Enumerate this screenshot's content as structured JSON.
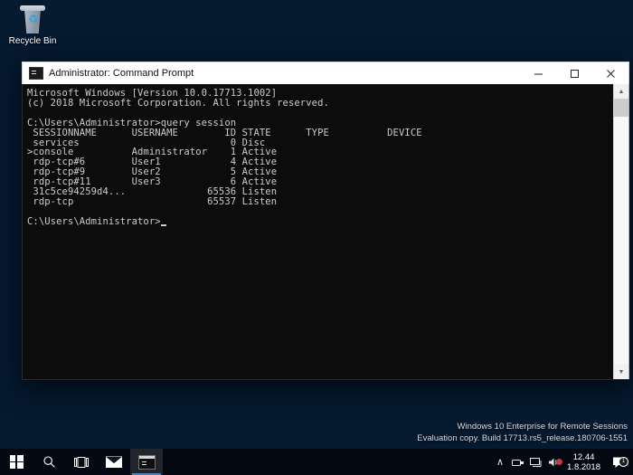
{
  "desktop": {
    "icons": [
      {
        "name": "recycle-bin",
        "label": "Recycle Bin"
      }
    ]
  },
  "window": {
    "title": "Administrator: Command Prompt",
    "icon": "cmd-icon",
    "controls": {
      "minimize": "–",
      "maximize": "□",
      "close": "✕"
    },
    "scrollbar": {
      "up_arrow": "▲",
      "down_arrow": "▼"
    },
    "console": {
      "banner": [
        "Microsoft Windows [Version 10.0.17713.1002]",
        "(c) 2018 Microsoft Corporation. All rights reserved."
      ],
      "prompt": "C:\\Users\\Administrator>",
      "command": "query session",
      "table": {
        "headers": [
          " SESSIONNAME",
          "USERNAME",
          "ID",
          "STATE",
          "TYPE",
          "DEVICE"
        ],
        "rows": [
          {
            "marker": " ",
            "sessionname": "services",
            "username": "",
            "id": "0",
            "state": "Disc",
            "type": "",
            "device": ""
          },
          {
            "marker": ">",
            "sessionname": "console",
            "username": "Administrator",
            "id": "1",
            "state": "Active",
            "type": "",
            "device": ""
          },
          {
            "marker": " ",
            "sessionname": "rdp-tcp#6",
            "username": "User1",
            "id": "4",
            "state": "Active",
            "type": "",
            "device": ""
          },
          {
            "marker": " ",
            "sessionname": "rdp-tcp#9",
            "username": "User2",
            "id": "5",
            "state": "Active",
            "type": "",
            "device": ""
          },
          {
            "marker": " ",
            "sessionname": "rdp-tcp#11",
            "username": "User3",
            "id": "6",
            "state": "Active",
            "type": "",
            "device": ""
          },
          {
            "marker": " ",
            "sessionname": "31c5ce94259d4...",
            "username": "",
            "id": "65536",
            "state": "Listen",
            "type": "",
            "device": ""
          },
          {
            "marker": " ",
            "sessionname": "rdp-tcp",
            "username": "",
            "id": "65537",
            "state": "Listen",
            "type": "",
            "device": ""
          }
        ]
      },
      "final_prompt": "C:\\Users\\Administrator>",
      "cursor": "_"
    }
  },
  "watermark": {
    "line1": "Windows 10 Enterprise for Remote Sessions",
    "line2": "Evaluation copy. Build 17713.rs5_release.180706-1551"
  },
  "taskbar": {
    "items": [
      {
        "name": "start-button",
        "icon": "windows-logo-icon",
        "active": false
      },
      {
        "name": "search-button",
        "icon": "search-icon",
        "active": false
      },
      {
        "name": "task-view-button",
        "icon": "task-view-icon",
        "active": false
      },
      {
        "name": "mail-app-button",
        "icon": "mail-icon",
        "active": false
      },
      {
        "name": "command-prompt-task",
        "icon": "cmd-icon",
        "active": true
      }
    ],
    "tray": {
      "show_hidden_icons": "∧",
      "icons": [
        {
          "name": "usb-icon",
          "glyph": "⌨"
        },
        {
          "name": "network-icon",
          "glyph": "⌨"
        },
        {
          "name": "volume-icon",
          "glyph": "◂"
        }
      ],
      "clock": {
        "time": "12.44",
        "date": "1.8.2018"
      },
      "action_center": {
        "name": "action-center-icon",
        "badge": "1"
      }
    }
  }
}
